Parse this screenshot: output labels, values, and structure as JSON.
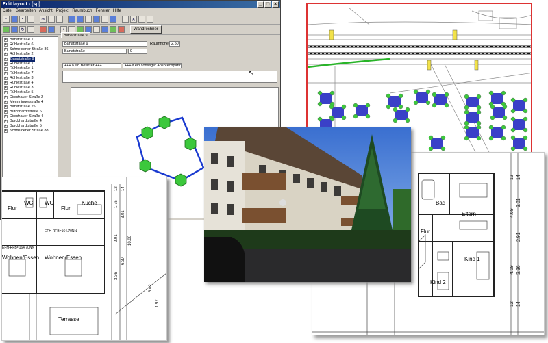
{
  "window": {
    "title": "Edit layout - [sp]",
    "buttons": [
      "_",
      "□",
      "×"
    ],
    "menu": [
      "Datei",
      "Bearbeiten",
      "Ansicht",
      "Projekt",
      "Raumbuch",
      "Fenster",
      "Hilfe"
    ],
    "toolbar_button": "Wandrechner"
  },
  "tree": {
    "items": [
      {
        "label": "Banatstraße 11",
        "selected": false
      },
      {
        "label": "Rühlestraße 6",
        "selected": false
      },
      {
        "label": "Schneidener Straße 86",
        "selected": false
      },
      {
        "label": "Rühlestraße 2",
        "selected": false
      },
      {
        "label": "Banatstraße 9",
        "selected": true
      },
      {
        "label": "Rühlestraße 1",
        "selected": false
      },
      {
        "label": "Rühlestraße 1",
        "selected": false
      },
      {
        "label": "Rühlestraße 7",
        "selected": false
      },
      {
        "label": "Rühlestraße 3",
        "selected": false
      },
      {
        "label": "Rühlestraße 4",
        "selected": false
      },
      {
        "label": "Rühlestraße 3",
        "selected": false
      },
      {
        "label": "Rühlestraße 5",
        "selected": false
      },
      {
        "label": "Dirschauer Straße 2",
        "selected": false
      },
      {
        "label": "Memmingerstraße 4",
        "selected": false
      },
      {
        "label": "Banatstraße 25",
        "selected": false
      },
      {
        "label": "Burckhardtstraße 6",
        "selected": false
      },
      {
        "label": "Dirschauer Straße 4",
        "selected": false
      },
      {
        "label": "Burckhardtstraße 4",
        "selected": false
      },
      {
        "label": "Burckhardtstraße 5",
        "selected": false
      },
      {
        "label": "Schneidener Straße 88",
        "selected": false
      }
    ]
  },
  "form": {
    "tab": "Banatstraße 9",
    "name_value": "Banatstraße 9",
    "street_value": "Banatstraße",
    "number_value": "9",
    "room_height_label": "Raumhöhe",
    "room_height_value": "2,50",
    "owner_value": "+++ Kein Besitzer +++",
    "contact_value": "+++ Kein sonstiger Ansprechpartner ++"
  },
  "plan_left": {
    "rooms": [
      "Flur",
      "WC",
      "WC",
      "Flur",
      "Küche",
      "Wohnen/Essen",
      "Wohnen/Essen",
      "Terrasse"
    ],
    "levels": [
      "EFH-RFB=164.70NN",
      "EFH-RFB=164.70NN"
    ],
    "dims": [
      "12",
      "14",
      "1.75",
      "3.01",
      "10.00",
      "6.37",
      "2.91",
      "3.36",
      "6.02",
      "1.97"
    ]
  },
  "plan_right": {
    "rooms": [
      "Bad",
      "Eltern",
      "Flur",
      "Kind 1",
      "Kind 2"
    ],
    "dims": [
      "12",
      "14",
      "3.01",
      "4.69",
      "2.91",
      "3.36",
      "4.69",
      "12",
      "14"
    ]
  },
  "colors": {
    "titlebar": "#0a246a",
    "map_border": "#dd3333",
    "shape_stroke": "#1a3ad0",
    "shape_node": "#3cc83c",
    "house": "#3a40c8",
    "green_path": "#28b428"
  }
}
